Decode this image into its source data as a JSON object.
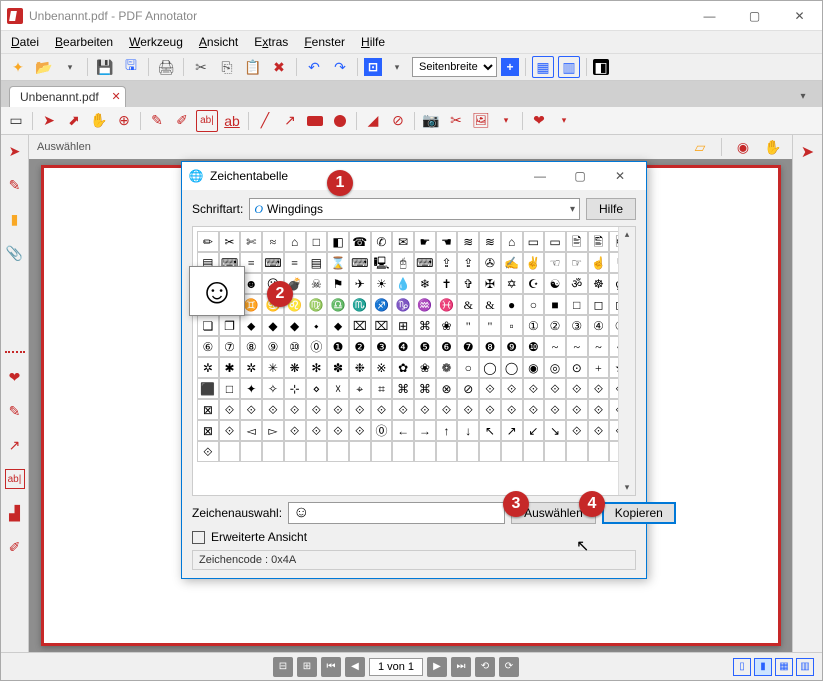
{
  "title": "Unbenannt.pdf - PDF Annotator",
  "menus": [
    "Datei",
    "Bearbeiten",
    "Werkzeug",
    "Ansicht",
    "Extras",
    "Fenster",
    "Hilfe"
  ],
  "zoom_mode": "Seitenbreite",
  "tab_name": "Unbenannt.pdf",
  "ann_label": "Auswählen",
  "page_info": "1 von 1",
  "dialog": {
    "title": "Zeichentabelle",
    "font_label": "Schriftart:",
    "font_value": "Wingdings",
    "help": "Hilfe",
    "selection_label": "Zeichenauswahl:",
    "selection_value": "☺",
    "btn_select": "Auswählen",
    "btn_copy": "Kopieren",
    "extended": "Erweiterte Ansicht",
    "code": "Zeichencode : 0x4A"
  },
  "markers": {
    "m1": "1",
    "m2": "2",
    "m3": "3",
    "m4": "4"
  },
  "chart_data": null,
  "font_o": "O",
  "glyphs": [
    "✏",
    "✂",
    "✄",
    "≈",
    "⌂",
    "□",
    "◧",
    "☎",
    "✆",
    "✉",
    "☛",
    "☚",
    "≋",
    "≋",
    "⌂",
    "▭",
    "▭",
    "🖹",
    "🖺",
    "🖻",
    "▤",
    "⌨",
    "≡",
    "⌨",
    "≡",
    "▤",
    "⌛",
    "⌨",
    "🖳",
    "🖰",
    "⌨",
    "⇪",
    "⇪",
    "✇",
    "✍",
    "✌",
    "☜",
    "☞",
    "☝",
    "☟",
    "✋",
    "☺",
    "☻",
    "☹",
    "💣",
    "☠",
    "⚑",
    "✈",
    "☀",
    "💧",
    "❄",
    "✝",
    "✞",
    "✠",
    "✡",
    "☪",
    "☯",
    "ॐ",
    "☸",
    "ღ",
    "♈",
    "♉",
    "♊",
    "♋",
    "♌",
    "♍",
    "♎",
    "♏",
    "♐",
    "♑",
    "♒",
    "♓",
    "&",
    "&",
    "●",
    "○",
    "■",
    "□",
    "◻",
    "◻",
    "❏",
    "❐",
    "⬥",
    "◆",
    "◆",
    "⬩",
    "⬥",
    "⌧",
    "⌧",
    "⊞",
    "⌘",
    "❀",
    "\"",
    "\"",
    "▫",
    "①",
    "②",
    "③",
    "④",
    "⑤",
    "⑥",
    "⑦",
    "⑧",
    "⑨",
    "⑩",
    "⓪",
    "❶",
    "❷",
    "❸",
    "❹",
    "❺",
    "❻",
    "❼",
    "❽",
    "❾",
    "❿",
    "~",
    "~",
    "~",
    "~",
    "✲",
    "✱",
    "✲",
    "✳",
    "❋",
    "✻",
    "✽",
    "❉",
    "※",
    "✿",
    "❀",
    "❁",
    "○",
    "◯",
    "◯",
    "◉",
    "◎",
    "⊙",
    "+",
    "★",
    "⬛",
    "□",
    "✦",
    "✧",
    "⊹",
    "⋄",
    "☓",
    "⌖",
    "⌗",
    "⌘",
    "⌘",
    "⊗",
    "⊘",
    "⟐",
    "⟐",
    "⟐",
    "⟐",
    "⟐",
    "⟐",
    "⟐",
    "⊠",
    "⟐",
    "⟐",
    "⟐",
    "⟐",
    "⟐",
    "⟐",
    "⟐",
    "⟐",
    "⟐",
    "⟐",
    "⟐",
    "⟐",
    "⟐",
    "⟐",
    "⟐",
    "⟐",
    "⟐",
    "⟐",
    "⟐",
    "⊠",
    "⟐",
    "◅",
    "▻",
    "⟐",
    "⟐",
    "⟐",
    "⟐",
    "⓪",
    "←",
    "→",
    "↑",
    "↓",
    "↖",
    "↗",
    "↙",
    "↘",
    "⟐",
    "⟐",
    "⟐",
    "⟐",
    "",
    "",
    "",
    "",
    "",
    "",
    "",
    "",
    "",
    "",
    "",
    "",
    "",
    "",
    "",
    "",
    "",
    "",
    ""
  ]
}
